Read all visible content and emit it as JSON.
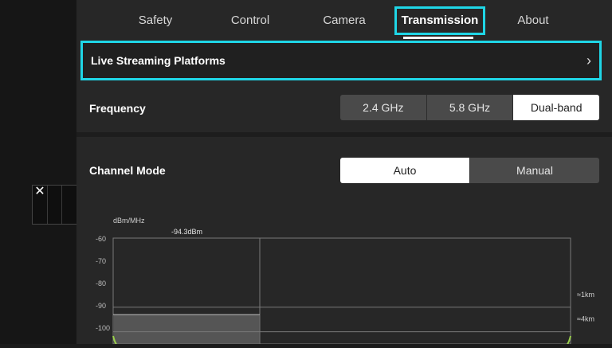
{
  "tabs": [
    {
      "label": "Safety",
      "active": false
    },
    {
      "label": "Control",
      "active": false
    },
    {
      "label": "Camera",
      "active": false
    },
    {
      "label": "Transmission",
      "active": true
    },
    {
      "label": "About",
      "active": false
    }
  ],
  "live_streaming": {
    "label": "Live Streaming Platforms"
  },
  "frequency": {
    "label": "Frequency",
    "options": [
      "2.4 GHz",
      "5.8 GHz",
      "Dual-band"
    ],
    "selected": "Dual-band"
  },
  "channel_mode": {
    "label": "Channel Mode",
    "options": [
      "Auto",
      "Manual"
    ],
    "selected": "Auto"
  },
  "side_widget": {
    "close_glyph": "✕"
  },
  "chart_data": {
    "type": "area",
    "ylabel": "dBm/MHz",
    "y_ticks": [
      "-60",
      "-70",
      "-80",
      "-90",
      "-100"
    ],
    "ylim": [
      -105,
      -60
    ],
    "marker_label": "-94.3dBm",
    "value": -94.3,
    "distance_labels": [
      "≈1km",
      "≈4km"
    ],
    "reference_lines": [
      -91,
      -102
    ],
    "colors": {
      "grid": "#7a7a7a",
      "fill": "#6a6a6a",
      "accent": "#9ad14b"
    }
  }
}
